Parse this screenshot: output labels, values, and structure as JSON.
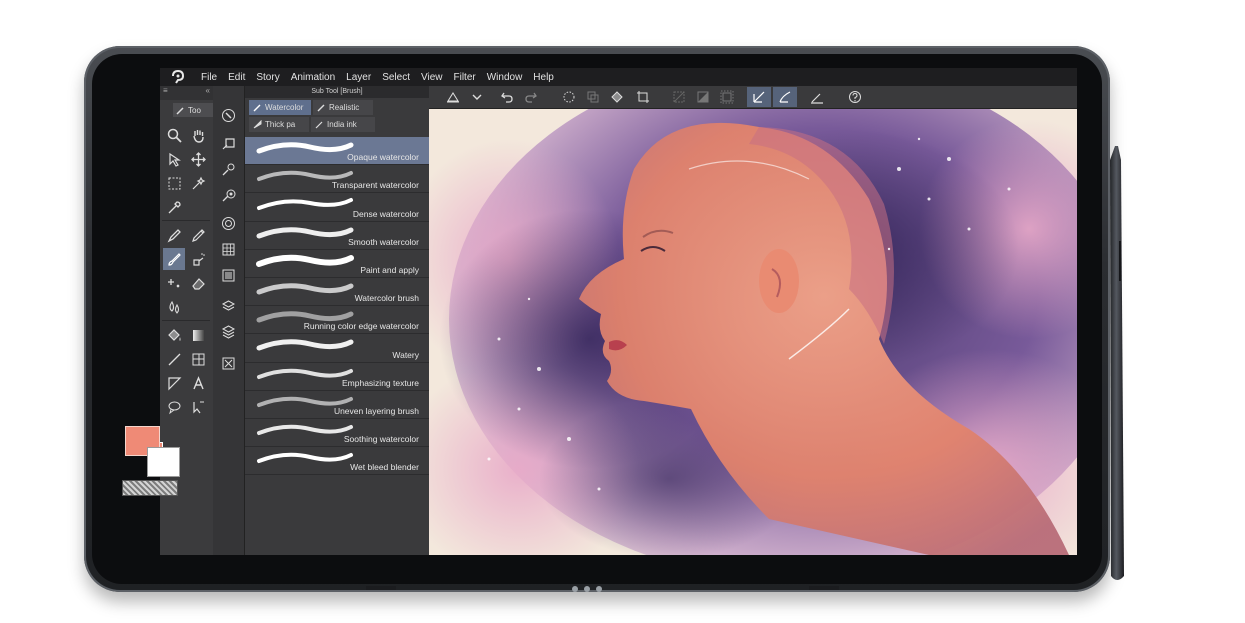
{
  "menu": [
    "File",
    "Edit",
    "Story",
    "Animation",
    "Layer",
    "Select",
    "View",
    "Filter",
    "Window",
    "Help"
  ],
  "tool_palette": {
    "tab_label": "Too",
    "main_color": "#ef8a76",
    "sub_color": "#ffffff"
  },
  "sub_tool": {
    "title": "Sub Tool [Brush]",
    "tabs": [
      "Watercolor",
      "Realistic",
      "Thick pa",
      "India ink"
    ],
    "active_tab": "Watercolor",
    "brushes": [
      "Opaque watercolor",
      "Transparent watercolor",
      "Dense watercolor",
      "Smooth watercolor",
      "Paint and apply",
      "Watercolor brush",
      "Running color edge watercolor",
      "Watery",
      "Emphasizing texture",
      "Uneven layering brush",
      "Soothing watercolor",
      "Wet bleed blender"
    ],
    "selected_brush": "Opaque watercolor"
  },
  "canvas": {
    "subject": "watercolor-portrait"
  },
  "colors": {
    "selection": "#6b7894",
    "panel": "#3a3a3c",
    "menubar": "#1e1e20"
  }
}
